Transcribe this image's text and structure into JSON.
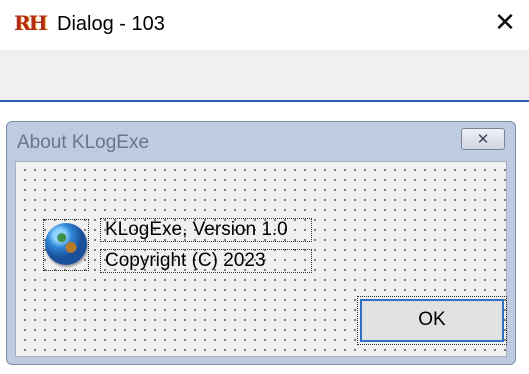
{
  "window": {
    "title": "Dialog - 103",
    "app_icon_text": "RH",
    "close_glyph": "✕"
  },
  "dialog": {
    "title": "About KLogExe",
    "close_glyph": "✕",
    "app_icon": "globe-icon",
    "line1": "KLogExe, Version 1.0",
    "line2": "Copyright (C) 2023",
    "ok_label": "OK"
  },
  "colors": {
    "accent": "#2f6fc6",
    "dialog_frame": "#bfcbe0",
    "client_bg": "#f0f0f0"
  }
}
